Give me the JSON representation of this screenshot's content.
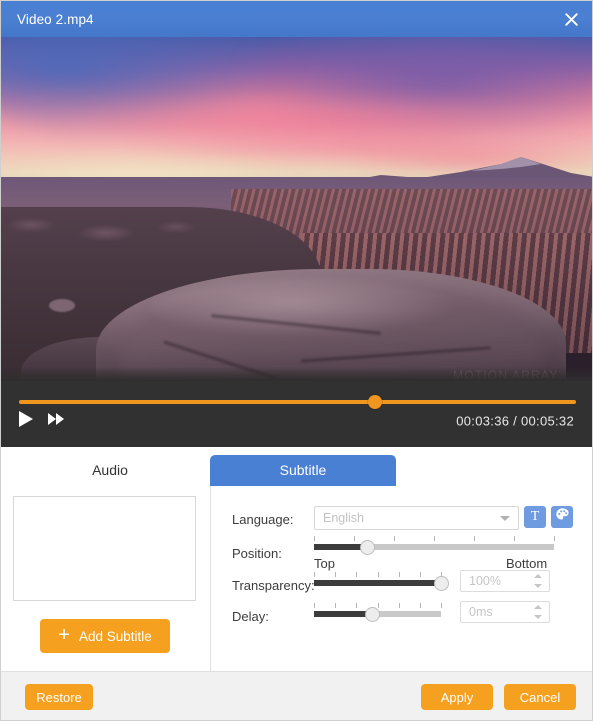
{
  "window": {
    "title": "Video 2.mp4",
    "close_icon": "close-icon"
  },
  "preview": {
    "watermark": "MOTION ARRAY"
  },
  "player": {
    "play_icon": "play-icon",
    "fast_forward_icon": "fast-forward-icon",
    "current_time": "00:03:36",
    "separator": "/",
    "total_time": "00:05:32",
    "time_display": "00:03:36 / 00:05:32",
    "seek_percent": 64
  },
  "tabs": [
    {
      "label": "Audio",
      "active": false
    },
    {
      "label": "Subtitle",
      "active": true
    }
  ],
  "subtitle_panel": {
    "list_items": [],
    "add_button": {
      "label": "Add Subtitle",
      "icon": "plus-icon"
    }
  },
  "settings": {
    "language": {
      "label": "Language:",
      "value": "",
      "placeholder": "English",
      "arrow_icon": "chevron-down-icon"
    },
    "text_style_button": {
      "icon": "text-style-icon",
      "glyph": "T"
    },
    "color_button": {
      "icon": "palette-icon"
    },
    "position": {
      "label": "Position:",
      "start_label": "Top",
      "end_label": "Bottom",
      "value_percent": 22,
      "ticks": 7
    },
    "transparency": {
      "label": "Transparency:",
      "value_percent": 100,
      "field_value": "",
      "field_placeholder": "100%",
      "ticks": 7
    },
    "delay": {
      "label": "Delay:",
      "value_percent": 46,
      "field_value": "",
      "field_placeholder": "0ms",
      "ticks": 7
    }
  },
  "footer": {
    "restore_label": "Restore",
    "apply_label": "Apply",
    "cancel_label": "Cancel"
  },
  "colors": {
    "accent_blue": "#4a80d4",
    "accent_orange": "#f5a01e",
    "seek_orange": "#f0961e",
    "player_bg": "#313131",
    "slider_fill": "#3c3c3c"
  }
}
